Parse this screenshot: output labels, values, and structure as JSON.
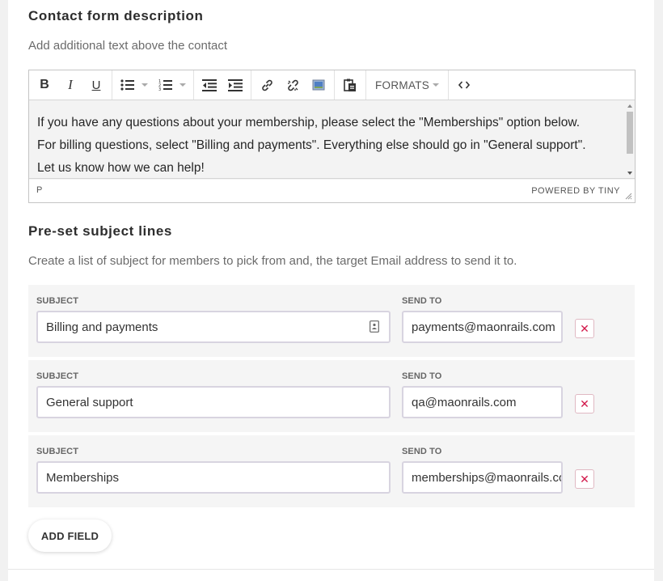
{
  "description_section": {
    "title": "Contact form description",
    "subtitle": "Add additional text above the contact"
  },
  "editor": {
    "toolbar": {
      "formats_label": "FORMATS",
      "buttons": [
        "bold-icon",
        "italic-icon",
        "underline-icon",
        "bullet-list-icon",
        "numbered-list-icon",
        "outdent-icon",
        "indent-icon",
        "link-icon",
        "unlink-icon",
        "image-icon",
        "paste-icon",
        "source-code-icon"
      ]
    },
    "content": {
      "line1": "If you have any questions about your membership, please select the \"Memberships\" option below.",
      "line2": "For billing questions, select \"Billing and payments\". Everything else should go in \"General support\".",
      "line3": "Let us know how we can help!"
    },
    "status": {
      "path": "P",
      "brand": "POWERED BY TINY"
    }
  },
  "subjects_section": {
    "title": "Pre-set subject lines",
    "subtitle": "Create a list of subject for members to pick from and, the target Email address to send it to.",
    "subject_label": "SUBJECT",
    "send_to_label": "SEND TO",
    "rows": [
      {
        "subject": "Billing and payments",
        "send_to": "payments@maonrails.com"
      },
      {
        "subject": "General support",
        "send_to": "qa@maonrails.com"
      },
      {
        "subject": "Memberships",
        "send_to": "memberships@maonrails.com"
      }
    ],
    "delete_symbol": "✕",
    "add_field_label": "ADD FIELD"
  },
  "colors": {
    "accent_delete": "#d2184a",
    "field_border": "#d8d4e0",
    "row_background": "#f5f5f5"
  }
}
